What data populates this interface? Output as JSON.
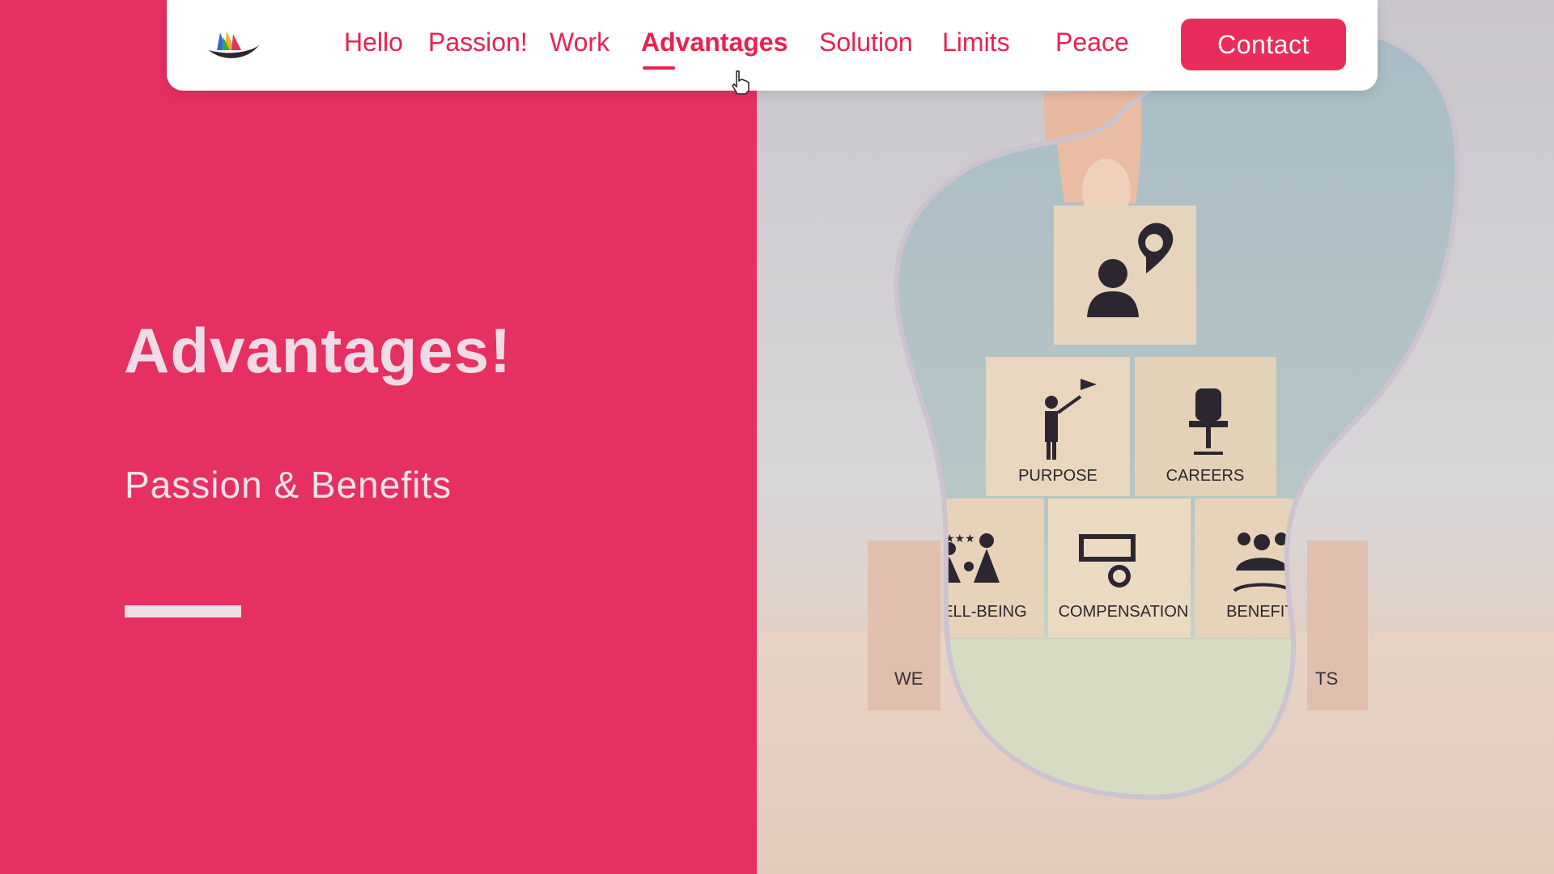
{
  "nav": {
    "items": [
      {
        "label": "Hello",
        "active": false
      },
      {
        "label": "Passion!",
        "active": false
      },
      {
        "label": "Work",
        "active": false
      },
      {
        "label": "Advantages",
        "active": true
      },
      {
        "label": "Solution",
        "active": false
      },
      {
        "label": "Limits",
        "active": false
      },
      {
        "label": "Peace",
        "active": false
      }
    ],
    "contact_label": "Contact"
  },
  "hero": {
    "title": "Advantages!",
    "subtitle": "Passion & Benefits"
  },
  "image": {
    "blocks": [
      {
        "label": "PURPOSE",
        "icon": "flag-person-icon"
      },
      {
        "label": "CAREERS",
        "icon": "office-chair-icon"
      },
      {
        "label": "WELL-BEING",
        "icon": "family-stars-icon"
      },
      {
        "label": "COMPENSATION",
        "icon": "money-stack-icon"
      },
      {
        "label": "BENEFITS",
        "icon": "team-hands-icon"
      }
    ],
    "top_block_icon": "employee-star-icon",
    "partial_left": "WE",
    "partial_right": "TS"
  },
  "colors": {
    "accent": "#e8224e",
    "panel": "#e63062",
    "button": "#ea2c5a"
  }
}
